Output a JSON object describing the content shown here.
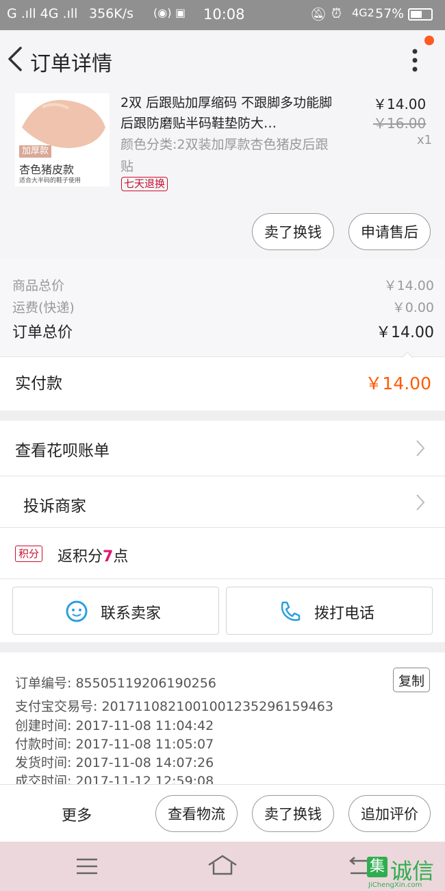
{
  "status_bar": {
    "left_text": "G .ıll 4G .ıll",
    "speed": "356K/s",
    "time": "10:08",
    "network": "4G2",
    "battery": "57%"
  },
  "header": {
    "title": "订单详情"
  },
  "product": {
    "title": "2双 后跟贴加厚缩码 不跟脚多功能脚后跟防磨贴半码鞋垫防大…",
    "attributes": "颜色分类:2双装加厚款杏色猪皮后跟贴",
    "badge": "七天退换",
    "price": "￥14.00",
    "original_price": "￥16.00",
    "quantity": "x1",
    "thumb_tag": "加厚款",
    "thumb_caption": "杏色猪皮款",
    "thumb_sub": "适合大半码的鞋子使用",
    "btn_sell": "卖了换钱",
    "btn_aftersale": "申请售后"
  },
  "totals": {
    "goods_label": "商品总价",
    "goods_value": "￥14.00",
    "shipping_label": "运费(快递)",
    "shipping_value": "￥0.00",
    "order_label": "订单总价",
    "order_value": "￥14.00",
    "paid_label": "实付款",
    "paid_value": "￥14.00"
  },
  "menu": {
    "huabei": "查看花呗账单",
    "complaint": "投诉商家",
    "points_badge": "积分",
    "points_prefix": "返积分",
    "points_count": "7",
    "points_suffix": "点",
    "contact_seller": "联系卖家",
    "call_phone": "拨打电话"
  },
  "order_info": {
    "order_no": "订单编号: 85505119206190256",
    "copy": "复制",
    "alipay_no": "支付宝交易号: 2017110821001001235296159463",
    "created": "创建时间: 2017-11-08  11:04:42",
    "paid": "付款时间: 2017-11-08  11:05:07",
    "shipped": "发货时间: 2017-11-08  14:07:26",
    "completed": "成交时间: 2017-11-12  12:59:08"
  },
  "bottom_bar": {
    "more": "更多",
    "logistics": "查看物流",
    "sell": "卖了换钱",
    "review": "追加评价"
  },
  "watermark": {
    "logo_char": "集",
    "text": "诚信",
    "url": "JiChengXin.com"
  },
  "colors": {
    "accent": "#ff5a00",
    "badge_red": "#c8102e",
    "icon_blue": "#2a9fe0"
  }
}
